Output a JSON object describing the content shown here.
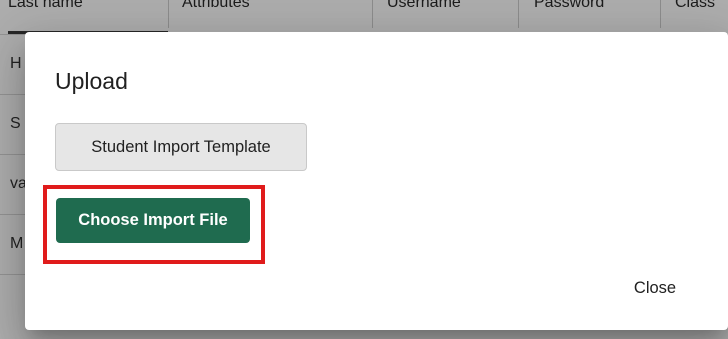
{
  "table": {
    "columns": [
      "Last name",
      "Attributes",
      "Username",
      "Password",
      "Class"
    ],
    "rows": [
      "H",
      "S",
      "va",
      "M"
    ]
  },
  "dialog": {
    "title": "Upload",
    "template_button": "Student Import Template",
    "import_button": "Choose Import File",
    "close_button": "Close"
  },
  "colors": {
    "primary_button": "#1f6b4f",
    "highlight": "#e01b1b",
    "secondary_button": "#e6e6e6"
  }
}
